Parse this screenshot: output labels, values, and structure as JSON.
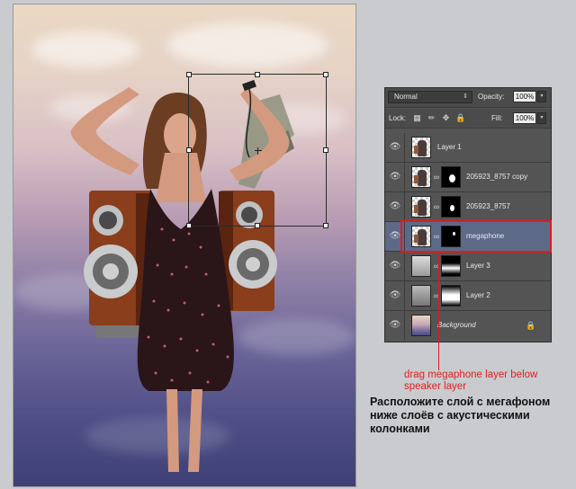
{
  "layers_panel": {
    "blend_mode": "Normal",
    "opacity_label": "Opacity:",
    "opacity_value": "100%",
    "lock_label": "Lock:",
    "fill_label": "Fill:",
    "fill_value": "100%",
    "layers": [
      {
        "name": "Layer 1",
        "has_mask": false,
        "selected": false
      },
      {
        "name": "205923_8757 copy",
        "has_mask": true,
        "selected": false
      },
      {
        "name": "205923_8757",
        "has_mask": true,
        "selected": false
      },
      {
        "name": "megaphone",
        "has_mask": true,
        "selected": true
      },
      {
        "name": "Layer 3",
        "has_mask": true,
        "selected": false
      },
      {
        "name": "Layer 2",
        "has_mask": true,
        "selected": false
      },
      {
        "name": "Background",
        "has_mask": false,
        "locked": true,
        "selected": false
      }
    ]
  },
  "annotation": {
    "english": "drag megaphone layer below speaker layer",
    "russian": "Расположите слой с мегафоном ниже слоёв с акустическими колонками",
    "highlight_color": "#e31b1b"
  },
  "icons": {
    "visibility": "eye-icon",
    "link": "chain-link-icon",
    "lock": "padlock-icon",
    "lock_transparent": "checkerboard-lock-icon",
    "lock_paint": "brush-lock-icon",
    "lock_move": "move-lock-icon"
  }
}
